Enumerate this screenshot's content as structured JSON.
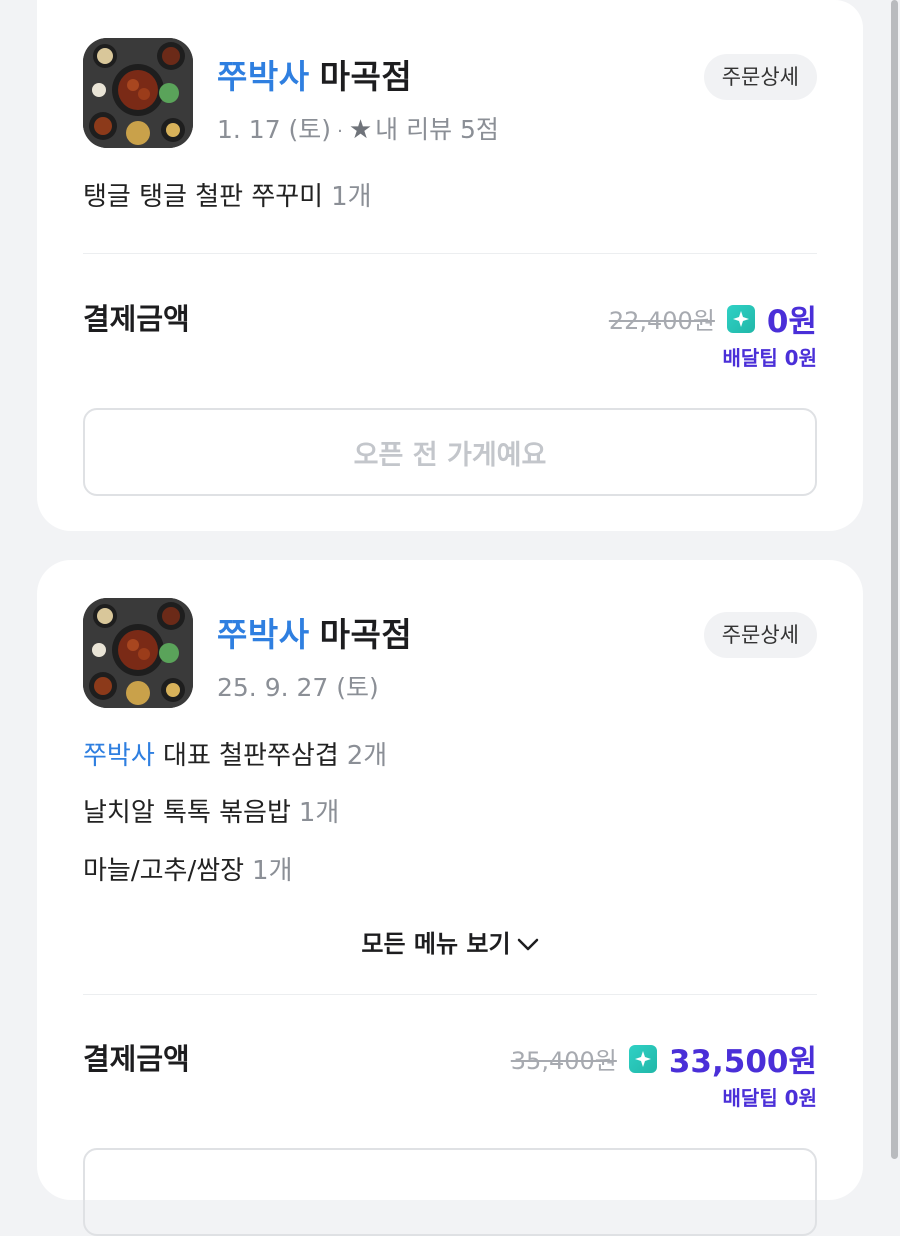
{
  "orders": [
    {
      "store_brand": "쭈박사",
      "store_branch": "마곡점",
      "date": "1. 17 (토)",
      "review": "내 리뷰 5점",
      "detail_label": "주문상세",
      "items": [
        {
          "name": "탱글 탱글 철판 쭈꾸미",
          "qty": "1개"
        }
      ],
      "payment_label": "결제금액",
      "original_price": "22,400원",
      "final_price": "0원",
      "delivery_tip": "배달팁 0원",
      "action_label": "오픈 전 가게예요"
    },
    {
      "store_brand": "쭈박사",
      "store_branch": "마곡점",
      "date": "25. 9. 27 (토)",
      "detail_label": "주문상세",
      "items": [
        {
          "brand": "쭈박사",
          "name": "대표 철판쭈삼겹",
          "qty": "2개"
        },
        {
          "name": "날치알 톡톡 볶음밥",
          "qty": "1개"
        },
        {
          "name": "마늘/고추/쌈장",
          "qty": "1개"
        }
      ],
      "all_menu_label": "모든 메뉴 보기",
      "payment_label": "결제금액",
      "original_price": "35,400원",
      "final_price": "33,500원",
      "delivery_tip": "배달팁 0원"
    }
  ],
  "colors": {
    "brand_blue": "#2f7fe0",
    "price_purple": "#4a2fd8",
    "club_teal": "#21b7a8",
    "background": "#f2f3f5"
  },
  "icons": [
    "star-icon",
    "club-badge-icon",
    "chevron-down-icon"
  ]
}
